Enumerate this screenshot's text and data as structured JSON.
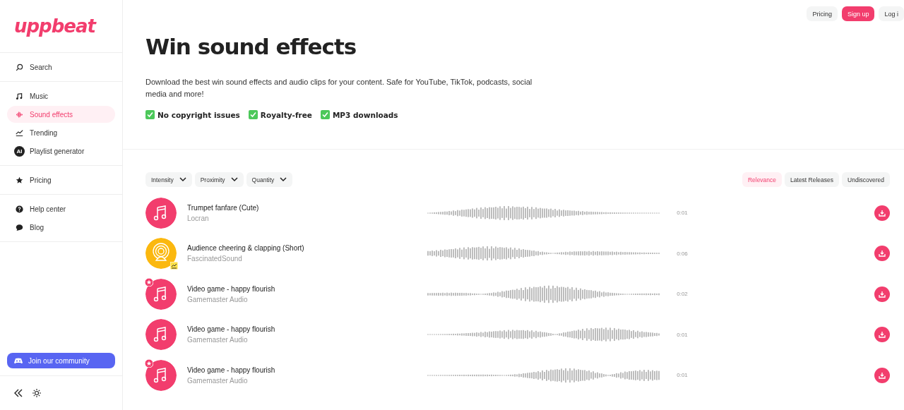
{
  "logo": "uppbeat",
  "sidebar": {
    "groups": [
      [
        {
          "label": "Search",
          "kind": "search",
          "selected": false
        }
      ],
      [
        {
          "label": "Music",
          "kind": "music",
          "selected": false
        },
        {
          "label": "Sound effects",
          "kind": "sfx",
          "selected": true
        },
        {
          "label": "Trending",
          "kind": "trending",
          "selected": false
        },
        {
          "label": "Playlist generator",
          "kind": "generator",
          "selected": false
        }
      ],
      [
        {
          "label": "Pricing",
          "kind": "pricing",
          "selected": false
        }
      ],
      [
        {
          "label": "Help center",
          "kind": "help",
          "selected": false
        },
        {
          "label": "Blog",
          "kind": "blog",
          "selected": false
        }
      ]
    ],
    "community_button": "Join our community",
    "ai_badge": "AI"
  },
  "top_buttons": [
    {
      "label": "Pricing",
      "kind": "plain"
    },
    {
      "label": "Sign up",
      "kind": "primary"
    },
    {
      "label": "Log i",
      "kind": "plain"
    }
  ],
  "title": "Win sound effects",
  "description": "Download the best win sound effects and audio clips for your content. Safe for YouTube, TikTok, podcasts, social media and more!",
  "features": [
    "No copyright issues",
    "Royalty-free",
    "MP3 downloads"
  ],
  "filters": [
    "Intensity",
    "Proximity",
    "Quantity"
  ],
  "sort_tabs": [
    {
      "label": "Relevance",
      "selected": true
    },
    {
      "label": "Latest Releases",
      "selected": false
    },
    {
      "label": "Undiscovered",
      "selected": false
    }
  ],
  "tracks": [
    {
      "title": "Trumpet fanfare (Cute)",
      "artist": "Locran",
      "duration": "0:01",
      "kind": "music",
      "starred": false,
      "trending": false
    },
    {
      "title": "Audience cheering & clapping (Short)",
      "artist": "FascinatedSound",
      "duration": "0:06",
      "kind": "ambience",
      "starred": false,
      "trending": true
    },
    {
      "title": "Video game - happy flourish",
      "artist": "Gamemaster Audio",
      "duration": "0:02",
      "kind": "music",
      "starred": true,
      "trending": false
    },
    {
      "title": "Video game - happy flourish",
      "artist": "Gamemaster Audio",
      "duration": "0:01",
      "kind": "music",
      "starred": false,
      "trending": false
    },
    {
      "title": "Video game - happy flourish",
      "artist": "Gamemaster Audio",
      "duration": "0:01",
      "kind": "music",
      "starred": true,
      "trending": false
    }
  ]
}
